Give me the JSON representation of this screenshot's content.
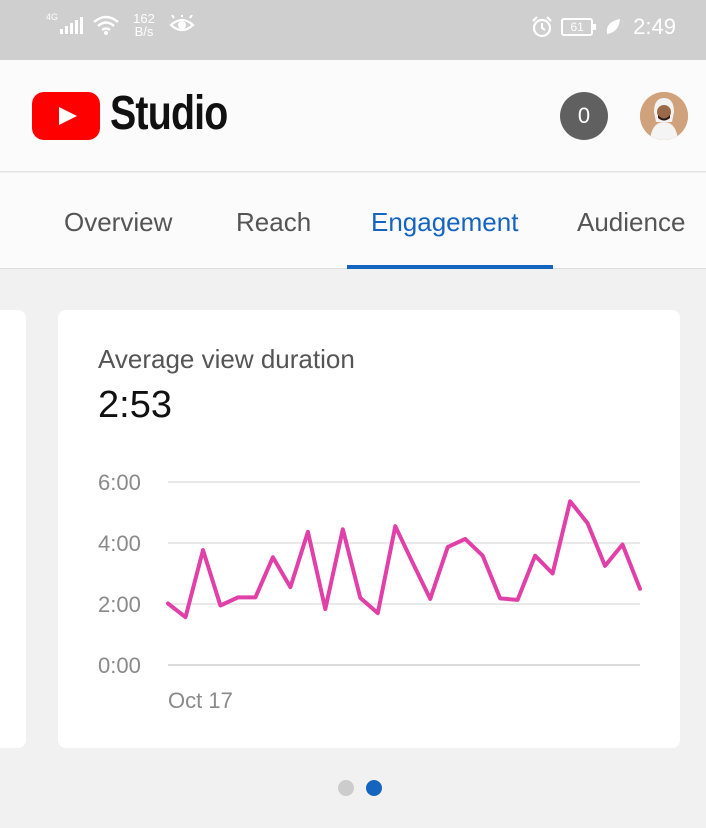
{
  "status_bar": {
    "network_type": "4G",
    "speed_value": "162",
    "speed_unit": "B/s",
    "battery": "61",
    "time": "2:49",
    "icons": [
      "signal-icon",
      "wifi-icon",
      "eye-icon",
      "alarm-icon",
      "battery-icon",
      "leaf-icon"
    ]
  },
  "app": {
    "logo_text": "Studio",
    "notification_count": "0",
    "accent": "#1565c0",
    "logo_color": "#ff0000"
  },
  "tabs": [
    {
      "label": "Overview",
      "active": false
    },
    {
      "label": "Reach",
      "active": false
    },
    {
      "label": "Engagement",
      "active": true
    },
    {
      "label": "Audience",
      "active": false
    }
  ],
  "card": {
    "title": "Average view duration",
    "value": "2:53"
  },
  "pager": {
    "count": 2,
    "active_index": 1
  },
  "chart_data": {
    "type": "line",
    "title": "",
    "xlabel": "",
    "ylabel": "",
    "x_tick_labels": [
      "Oct 17"
    ],
    "y_tick_labels": [
      "0:00",
      "2:00",
      "4:00",
      "6:00"
    ],
    "ylim": [
      0,
      360
    ],
    "grid": true,
    "series": [
      {
        "color": "#e040a8",
        "values": [
          121,
          94,
          226,
          117,
          133,
          133,
          212,
          153,
          262,
          110,
          267,
          132,
          102,
          273,
          201,
          130,
          232,
          248,
          215,
          131,
          128,
          215,
          180,
          322,
          279,
          195,
          237,
          150
        ]
      }
    ]
  }
}
